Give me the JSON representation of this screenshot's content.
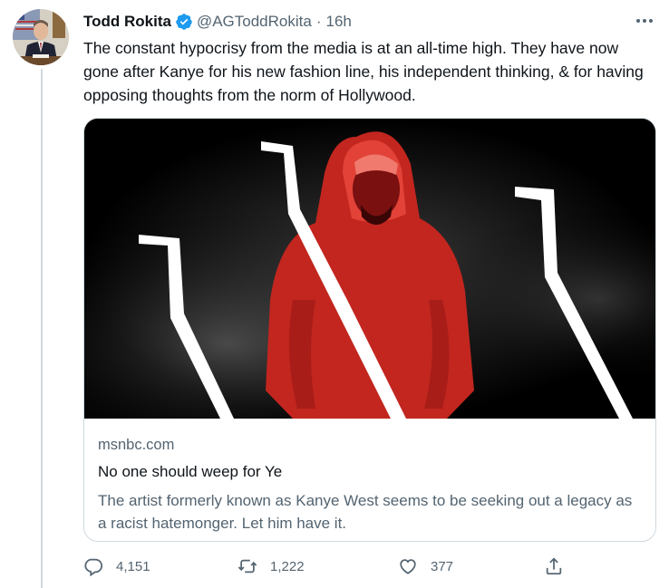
{
  "tweet": {
    "author_name": "Todd Rokita",
    "handle": "@AGToddRokita",
    "separator": "·",
    "time": "16h",
    "text": "The constant hypocrisy from the media is at an all-time high. They have now gone after Kanye for his new fashion line, his independent thinking, & for having opposing thoughts from the norm of Hollywood.",
    "verified": true
  },
  "card": {
    "domain": "msnbc.com",
    "title": "No one should weep for Ye",
    "description": "The artist formerly known as Kanye West seems to be seeking out a legacy as a racist hatemonger. Let him have it."
  },
  "actions": {
    "replies": "4,151",
    "retweets": "1,222",
    "likes": "377"
  },
  "icons": {
    "verified": "verified-badge-icon",
    "more": "more-horizontal-icon",
    "reply": "reply-icon",
    "retweet": "retweet-icon",
    "like": "heart-icon",
    "share": "share-icon"
  },
  "colors": {
    "verified_blue": "#1d9bf0",
    "secondary_text": "#536471",
    "border": "#cfd9de",
    "image_red": "#d4322f"
  }
}
